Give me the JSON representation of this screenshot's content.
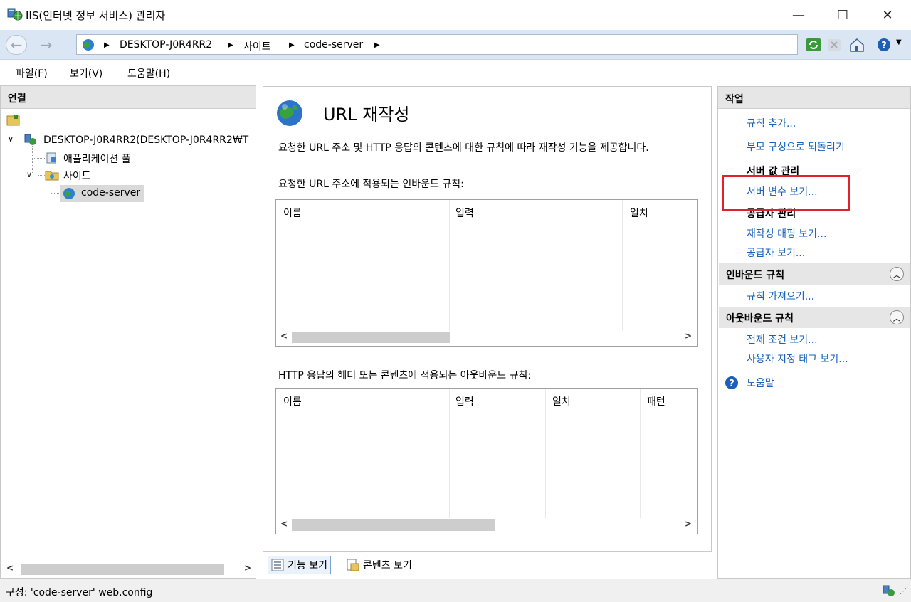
{
  "window": {
    "title": "IIS(인터넷 정보 서비스) 관리자",
    "minimize": "—",
    "maximize": "☐",
    "close": "✕"
  },
  "address": {
    "crumbs": [
      "DESKTOP-J0R4RR2",
      "사이트",
      "code-server"
    ]
  },
  "menu": {
    "file": "파일(F)",
    "view": "보기(V)",
    "help": "도움말(H)"
  },
  "connections": {
    "header": "연결",
    "tree": {
      "server": "DESKTOP-J0R4RR2(DESKTOP-J0R4RR2₩T",
      "app_pools": "애플리케이션 풀",
      "sites": "사이트",
      "site": "code-server"
    }
  },
  "feature": {
    "title": "URL 재작성",
    "description": "요청한 URL 주소 및 HTTP 응답의 콘텐츠에 대한 규칙에 따라 재작성 기능을 제공합니다.",
    "inbound_label": "요청한 URL 주소에 적용되는 인바운드 규칙:",
    "inbound_columns": [
      "이름",
      "입력",
      "일치"
    ],
    "outbound_label": "HTTP 응답의 헤더 또는 콘텐츠에 적용되는 아웃바운드 규칙:",
    "outbound_columns": [
      "이름",
      "입력",
      "일치",
      "패턴"
    ]
  },
  "tabs": {
    "features_view": "기능 보기",
    "content_view": "콘텐츠 보기"
  },
  "actions": {
    "header": "작업",
    "add_rule": "규칙 추가...",
    "revert_parent": "부모 구성으로 되돌리기",
    "server_values_title": "서버 값 관리",
    "view_server_vars": "서버 변수 보기...",
    "providers_title": "공급자 관리",
    "view_rewrite_maps": "재작성 매핑 보기...",
    "view_providers": "공급자 보기...",
    "inbound_section": "인바운드 규칙",
    "import_rules": "규칙 가져오기...",
    "outbound_section": "아웃바운드 규칙",
    "view_preconditions": "전제 조건 보기...",
    "view_custom_tags": "사용자 지정 태그 보기...",
    "help": "도움말"
  },
  "status": {
    "text": "구성: 'code-server' web.config"
  },
  "colors": {
    "link": "#1a62b8",
    "highlight": "#e0202a",
    "address_bar": "#dbe6f4"
  }
}
